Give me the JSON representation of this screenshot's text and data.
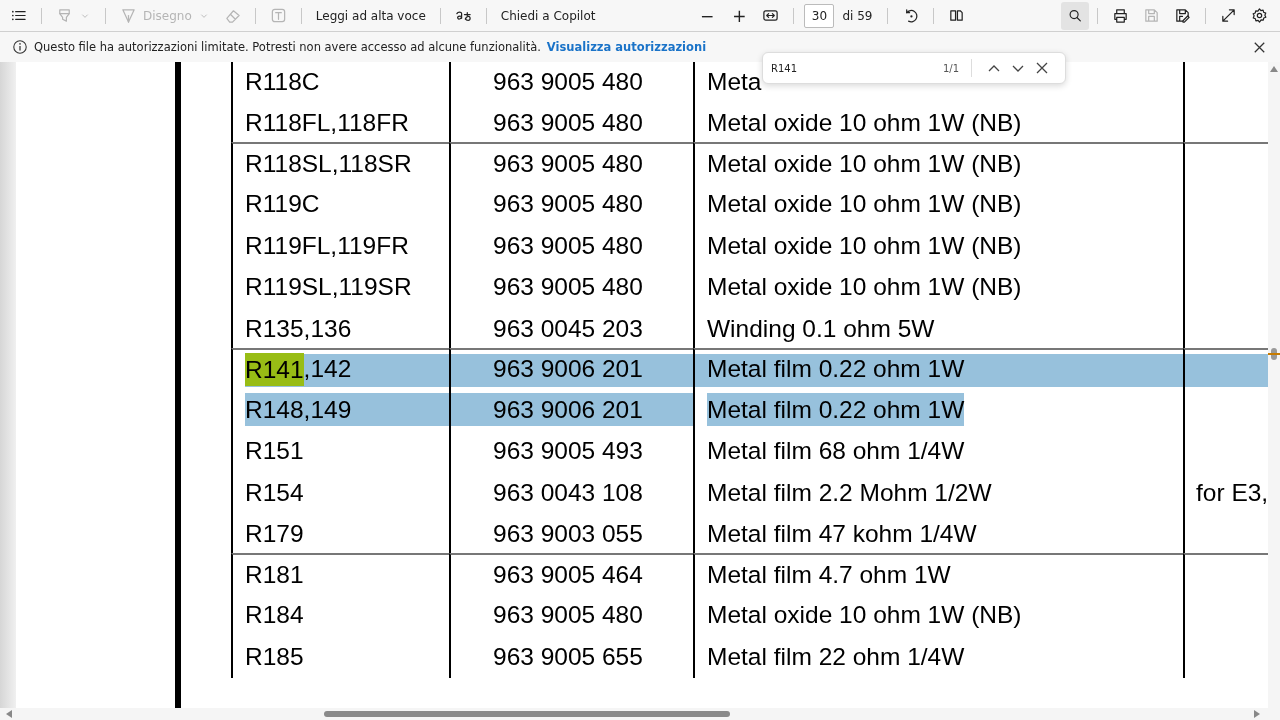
{
  "toolbar": {
    "left": [
      {
        "kind": "button",
        "disabled": false
      },
      {
        "kind": "separator"
      },
      {
        "kind": "button",
        "disabled": true,
        "dropdown": true
      },
      {
        "kind": "separator"
      },
      {
        "kind": "button",
        "label": "Disegno",
        "disabled": true,
        "dropdown": true
      },
      {
        "kind": "button",
        "disabled": true
      },
      {
        "kind": "separator"
      },
      {
        "kind": "button",
        "disabled": true
      },
      {
        "kind": "separator"
      },
      {
        "kind": "button",
        "label": "Leggi ad alta voce",
        "disabled": false
      },
      {
        "kind": "separator"
      },
      {
        "kind": "button",
        "disabled": false
      },
      {
        "kind": "separator"
      },
      {
        "kind": "button",
        "label": "Chiedi a Copilot",
        "disabled": false
      },
      {
        "kind": "spacer"
      },
      {
        "kind": "button",
        "label": "−",
        "disabled": false
      },
      {
        "kind": "button",
        "label": "+",
        "disabled": false
      },
      {
        "kind": "button",
        "disabled": false
      },
      {
        "kind": "separator"
      },
      {
        "kind": "page",
        "value": "30",
        "total": "di 59"
      },
      {
        "kind": "separator"
      },
      {
        "kind": "button",
        "disabled": false
      },
      {
        "kind": "separator"
      },
      {
        "kind": "button",
        "disabled": false
      },
      {
        "kind": "spacer"
      },
      {
        "kind": "button",
        "disabled": false,
        "selected": true
      },
      {
        "kind": "separator"
      },
      {
        "kind": "button",
        "disabled": false
      },
      {
        "kind": "button",
        "disabled": true
      },
      {
        "kind": "button",
        "disabled": false
      },
      {
        "kind": "separator"
      },
      {
        "kind": "button",
        "disabled": false
      },
      {
        "kind": "button",
        "disabled": false
      }
    ]
  },
  "info_bar": {
    "message": "Questo file ha autorizzazioni limitate. Potresti non avere accesso ad alcune funzionalità.",
    "link": "Visualizza autorizzazioni"
  },
  "find_bar": {
    "query": "R141",
    "count": "1/1"
  },
  "table": {
    "rows": [
      {
        "part": [
          {
            "text": "R118C",
            "match": false
          }
        ],
        "code": "963 9005 480",
        "description": "Meta",
        "group_start": false,
        "selected": false
      },
      {
        "part": [
          {
            "text": "R118FL,118FR",
            "match": false
          }
        ],
        "code": "963 9005 480",
        "description": "Metal oxide 10 ohm 1W (NB)",
        "group_start": false,
        "selected": false
      },
      {
        "part": [
          {
            "text": "R118SL,118SR",
            "match": false
          }
        ],
        "code": "963 9005 480",
        "description": "Metal oxide 10 ohm 1W (NB)",
        "group_start": true,
        "selected": false
      },
      {
        "part": [
          {
            "text": "R119C",
            "match": false
          }
        ],
        "code": "963 9005 480",
        "description": "Metal oxide 10 ohm 1W (NB)",
        "group_start": false,
        "selected": false
      },
      {
        "part": [
          {
            "text": "R119FL,119FR",
            "match": false
          }
        ],
        "code": "963 9005 480",
        "description": "Metal oxide 10 ohm 1W (NB)",
        "group_start": false,
        "selected": false
      },
      {
        "part": [
          {
            "text": "R119SL,119SR",
            "match": false
          }
        ],
        "code": "963 9005 480",
        "description": "Metal oxide 10 ohm 1W (NB)",
        "group_start": false,
        "selected": false
      },
      {
        "part": [
          {
            "text": "R135,136",
            "match": false
          }
        ],
        "code": "963 0045 203",
        "description": "Winding 0.1 ohm 5W",
        "group_start": false,
        "selected": false
      },
      {
        "part": [
          {
            "text": "R141",
            "match": true
          },
          {
            "text": ",142",
            "match": false
          }
        ],
        "code": "963 9006 201",
        "description": "Metal film 0.22 ohm 1W",
        "group_start": true,
        "selected": true,
        "full_width": true
      },
      {
        "part": [
          {
            "text": "R148,149",
            "match": false
          }
        ],
        "code": "963 9006 201",
        "description": "Metal film 0.22 ohm 1W",
        "group_start": false,
        "selected": true,
        "full_width": false
      },
      {
        "part": [
          {
            "text": "R151",
            "match": false
          }
        ],
        "code": "963 9005 493",
        "description": "Metal film 68 ohm 1/4W",
        "group_start": false,
        "selected": false
      },
      {
        "part": [
          {
            "text": "R154",
            "match": false
          }
        ],
        "code": "963 0043 108",
        "description": "Metal film 2.2 Mohm 1/2W",
        "note": "for E3,",
        "group_start": false,
        "selected": false
      },
      {
        "part": [
          {
            "text": "R179",
            "match": false
          }
        ],
        "code": "963 9003 055",
        "description": "Metal film 47 kohm 1/4W",
        "group_start": false,
        "selected": false
      },
      {
        "part": [
          {
            "text": "R181",
            "match": false
          }
        ],
        "code": "963 9005 464",
        "description": "Metal film 4.7 ohm 1W",
        "group_start": true,
        "selected": false
      },
      {
        "part": [
          {
            "text": "R184",
            "match": false
          }
        ],
        "code": "963 9005 480",
        "description": "Metal oxide 10 ohm 1W (NB)",
        "group_start": false,
        "selected": false
      },
      {
        "part": [
          {
            "text": "R185",
            "match": false
          }
        ],
        "code": "963 9005 655",
        "description": "Metal film 22 ohm 1/4W",
        "group_start": false,
        "selected": false
      }
    ]
  }
}
